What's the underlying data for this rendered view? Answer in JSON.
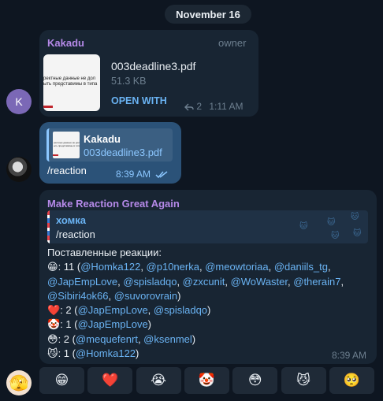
{
  "date_label": "November 16",
  "msg1": {
    "avatar_letter": "K",
    "sender": "Kakadu",
    "role": "owner",
    "file_name": "003deadline3.pdf",
    "file_size": "51.3 KB",
    "open_with": "OPEN WITH",
    "forwards": "2",
    "time": "1:11 AM",
    "thumb_text_1": "ректные данные не дол",
    "thumb_text_2": "ыть представимы в типа"
  },
  "msg2": {
    "reply_title": "Kakadu",
    "reply_file": "003deadline3.pdf",
    "text": "/reaction",
    "time": "8:39 AM"
  },
  "msg3": {
    "sender": "Make Reaction Great Again",
    "quote_name": "хомка",
    "quote_text": "/reaction",
    "heading": "Поставленные реакции:",
    "time": "8:39 AM",
    "reactions": [
      {
        "emoji": "😁",
        "count": ": 11 (",
        "mentions": [
          "@Homka122",
          "@p10nerka",
          "@meowtoriaa",
          "@daniils_tg",
          "@JapEmpLove",
          "@spisladqo",
          "@zxcunit",
          "@WoWaster",
          "@therain7",
          "@Sibiri4ok66",
          "@suvorovrain"
        ]
      },
      {
        "emoji": "❤️",
        "count": ": 2 (",
        "mentions": [
          "@JapEmpLove",
          "@spisladqo"
        ]
      },
      {
        "emoji": "🤡",
        "count": ": 1 (",
        "mentions": [
          "@JapEmpLove"
        ]
      },
      {
        "emoji": "😳",
        "count": ": 2 (",
        "mentions": [
          "@mequefenrt",
          "@ksenmel"
        ]
      },
      {
        "emoji": "😼",
        "count": ": 1 (",
        "mentions": [
          "@Homka122"
        ]
      }
    ]
  },
  "keyboard": [
    "😁",
    "❤️",
    "😭",
    "🤡",
    "😳",
    "😼",
    "🥺"
  ],
  "avatar3_emoji": "🫣"
}
